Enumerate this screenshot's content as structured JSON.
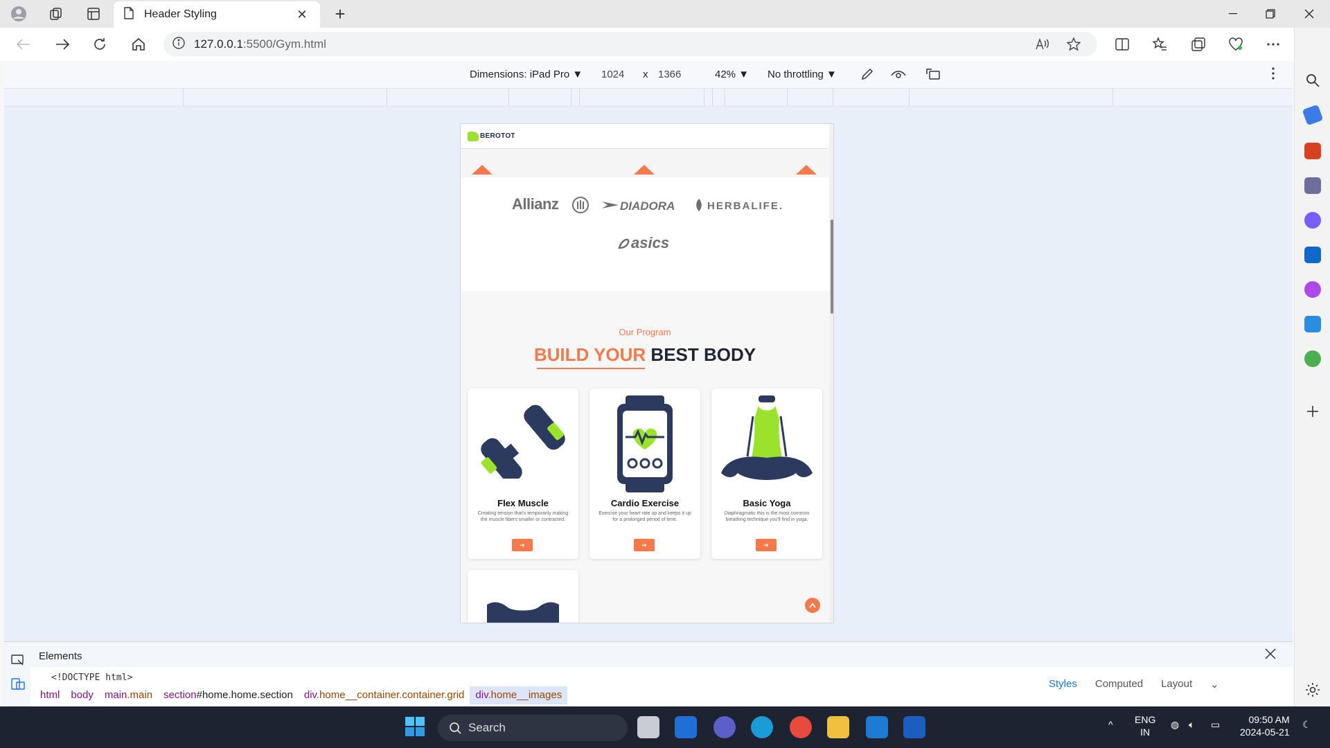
{
  "browser": {
    "tab_title": "Header Styling",
    "url_host": "127.0.0.1",
    "url_rest": ":5500/Gym.html",
    "new_tab": "+",
    "close_tab": "✕"
  },
  "device_toolbar": {
    "dimensions_label": "Dimensions: iPad Pro",
    "width": "1024",
    "times": "x",
    "height": "1366",
    "zoom": "42%",
    "throttling": "No throttling"
  },
  "page": {
    "logo": "BEROTOT",
    "sponsors": [
      "Allianz",
      "DIADORA",
      "HERBALIFE.",
      "asics"
    ],
    "program_subtitle": "Our Program",
    "program_title_accent": "BUILD YOUR",
    "program_title_rest": " BEST BODY",
    "cards": [
      {
        "title": "Flex Muscle",
        "description": "Creating tension that's temporarily making the muscle fibers smaller or contracted.",
        "button": "➔"
      },
      {
        "title": "Cardio Exercise",
        "description": "Exercise your heart rate up and keeps it up for a prolonged period of time.",
        "button": "➔"
      },
      {
        "title": "Basic Yoga",
        "description": "Diaphragmatic this is the most common breathing technique you'll find in yoga.",
        "button": "➔"
      }
    ],
    "scroll_top": "^"
  },
  "devtools": {
    "panel_label": "Elements",
    "doctype": "<!DOCTYPE html>",
    "breadcrumbs": [
      {
        "tag": "html",
        "attr": ""
      },
      {
        "tag": "body",
        "attr": ""
      },
      {
        "tag": "main",
        "attr": ".main"
      },
      {
        "tag": "section",
        "attr": "#home.home.section"
      },
      {
        "tag": "div",
        "attr": ".home__container.container.grid"
      },
      {
        "tag": "div",
        "attr": ".home__images"
      }
    ],
    "side_tabs": [
      "Styles",
      "Computed",
      "Layout"
    ]
  },
  "taskbar": {
    "search_label": "Search",
    "lang_1": "ENG",
    "lang_2": "IN",
    "time": "09:50 AM",
    "date": "2024-05-21"
  },
  "colors": {
    "accent": "#f6794b",
    "navy": "#2b3a5e",
    "lime": "#9be22d"
  }
}
